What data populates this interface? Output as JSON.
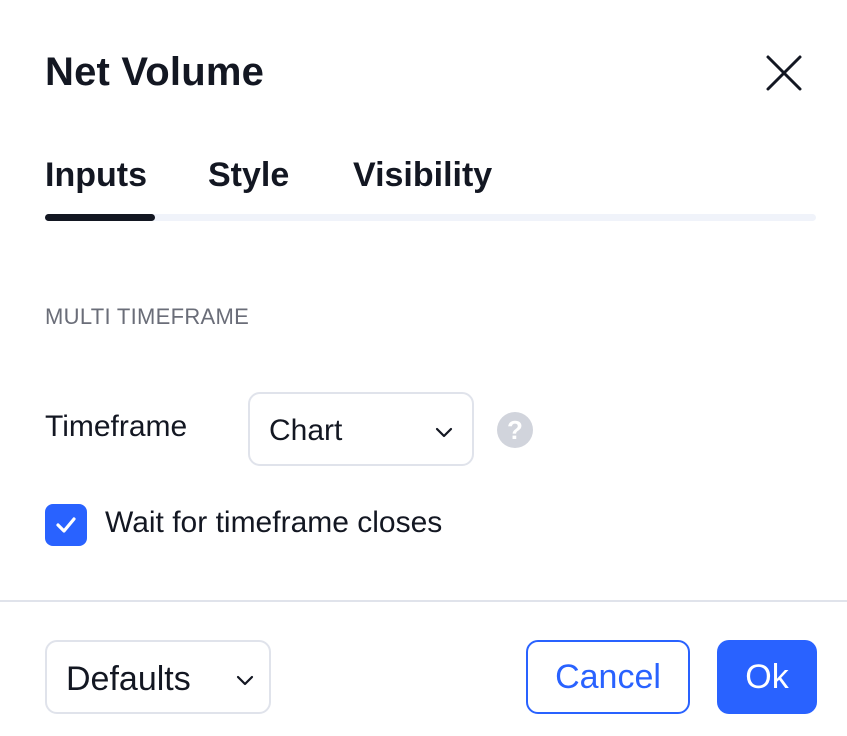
{
  "dialog": {
    "title": "Net Volume",
    "close_icon": "close-icon"
  },
  "tabs": [
    {
      "label": "Inputs",
      "active": true
    },
    {
      "label": "Style",
      "active": false
    },
    {
      "label": "Visibility",
      "active": false
    }
  ],
  "inputs": {
    "section_title": "MULTI TIMEFRAME",
    "timeframe": {
      "label": "Timeframe",
      "value": "Chart",
      "help_icon": "question-icon"
    },
    "wait_for_closes": {
      "label": "Wait for timeframe closes",
      "checked": true
    }
  },
  "footer": {
    "defaults_label": "Defaults",
    "cancel_label": "Cancel",
    "ok_label": "Ok"
  },
  "colors": {
    "accent": "#2962ff",
    "text": "#131722",
    "muted": "#6a6d78",
    "border": "#e0e3eb",
    "help_bg": "#d1d4dc"
  }
}
